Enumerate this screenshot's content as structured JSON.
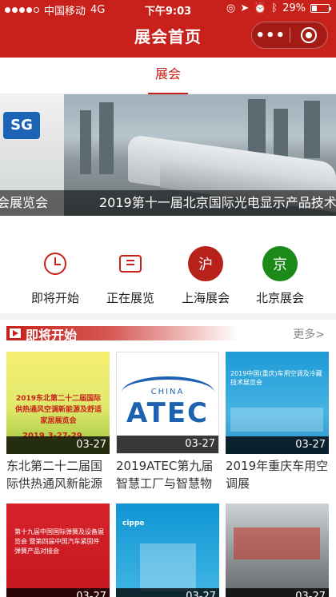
{
  "status_bar": {
    "carrier": "中国移动",
    "network": "4G",
    "time": "下午9:03",
    "battery": "29%"
  },
  "header": {
    "title": "展会首页",
    "capsule_more": "•••"
  },
  "tabs": [
    {
      "label": "展会",
      "active": true
    }
  ],
  "banner": {
    "caption_left": "会展览会",
    "caption_right": "2019第十一届北京国际光电显示产品技术展"
  },
  "quick_links": [
    {
      "label": "即将开始",
      "icon": "clock-icon"
    },
    {
      "label": "正在展览",
      "icon": "exhibit-icon"
    },
    {
      "label": "上海展会",
      "icon": "shanghai-badge",
      "badge": "沪"
    },
    {
      "label": "北京展会",
      "icon": "beijing-badge",
      "badge": "京"
    }
  ],
  "section": {
    "title": "即将开始",
    "more": "更多>"
  },
  "cards": [
    {
      "date": "03-27",
      "title": "东北第二十二届国际供热通风新能源",
      "thumb_text": "2019东北第二十二届国际供热通风空调新能源及舒适家居展览会",
      "thumb_date": "2019.3-27-29"
    },
    {
      "date": "03-27",
      "title": "2019ATEC第九届智慧工厂与智慧物流",
      "thumb_china": "CHINA",
      "thumb_atec": "ATEC"
    },
    {
      "date": "03-27",
      "title": "2019年重庆车用空调展",
      "thumb_text": "2019中国(重庆)车用空调及冷藏技术展览会"
    },
    {
      "date": "03-27",
      "title": "",
      "thumb_text": "第十九届中国国际弹簧及设备展览会 暨第四届中国汽车紧固件弹簧产品对接会"
    },
    {
      "date": "03-27",
      "title": "",
      "thumb_text": "cippe"
    },
    {
      "date": "03-27",
      "title": ""
    }
  ],
  "colors": {
    "brand_red": "#c8201a",
    "beijing_green": "#1b8a19"
  }
}
